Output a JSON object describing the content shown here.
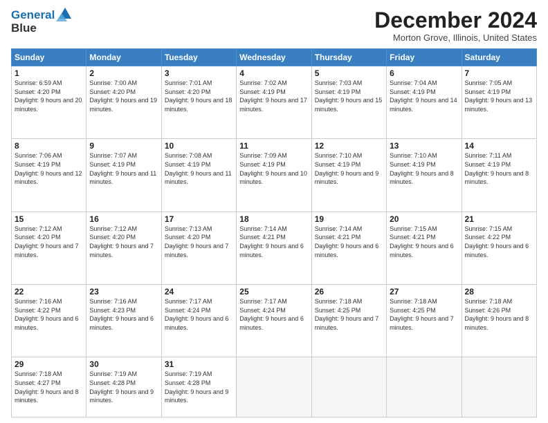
{
  "logo": {
    "line1": "General",
    "line2": "Blue"
  },
  "title": "December 2024",
  "location": "Morton Grove, Illinois, United States",
  "days_of_week": [
    "Sunday",
    "Monday",
    "Tuesday",
    "Wednesday",
    "Thursday",
    "Friday",
    "Saturday"
  ],
  "weeks": [
    [
      {
        "day": 1,
        "sunrise": "6:59 AM",
        "sunset": "4:20 PM",
        "daylight": "9 hours and 20 minutes."
      },
      {
        "day": 2,
        "sunrise": "7:00 AM",
        "sunset": "4:20 PM",
        "daylight": "9 hours and 19 minutes."
      },
      {
        "day": 3,
        "sunrise": "7:01 AM",
        "sunset": "4:20 PM",
        "daylight": "9 hours and 18 minutes."
      },
      {
        "day": 4,
        "sunrise": "7:02 AM",
        "sunset": "4:19 PM",
        "daylight": "9 hours and 17 minutes."
      },
      {
        "day": 5,
        "sunrise": "7:03 AM",
        "sunset": "4:19 PM",
        "daylight": "9 hours and 15 minutes."
      },
      {
        "day": 6,
        "sunrise": "7:04 AM",
        "sunset": "4:19 PM",
        "daylight": "9 hours and 14 minutes."
      },
      {
        "day": 7,
        "sunrise": "7:05 AM",
        "sunset": "4:19 PM",
        "daylight": "9 hours and 13 minutes."
      }
    ],
    [
      {
        "day": 8,
        "sunrise": "7:06 AM",
        "sunset": "4:19 PM",
        "daylight": "9 hours and 12 minutes."
      },
      {
        "day": 9,
        "sunrise": "7:07 AM",
        "sunset": "4:19 PM",
        "daylight": "9 hours and 11 minutes."
      },
      {
        "day": 10,
        "sunrise": "7:08 AM",
        "sunset": "4:19 PM",
        "daylight": "9 hours and 11 minutes."
      },
      {
        "day": 11,
        "sunrise": "7:09 AM",
        "sunset": "4:19 PM",
        "daylight": "9 hours and 10 minutes."
      },
      {
        "day": 12,
        "sunrise": "7:10 AM",
        "sunset": "4:19 PM",
        "daylight": "9 hours and 9 minutes."
      },
      {
        "day": 13,
        "sunrise": "7:10 AM",
        "sunset": "4:19 PM",
        "daylight": "9 hours and 8 minutes."
      },
      {
        "day": 14,
        "sunrise": "7:11 AM",
        "sunset": "4:19 PM",
        "daylight": "9 hours and 8 minutes."
      }
    ],
    [
      {
        "day": 15,
        "sunrise": "7:12 AM",
        "sunset": "4:20 PM",
        "daylight": "9 hours and 7 minutes."
      },
      {
        "day": 16,
        "sunrise": "7:12 AM",
        "sunset": "4:20 PM",
        "daylight": "9 hours and 7 minutes."
      },
      {
        "day": 17,
        "sunrise": "7:13 AM",
        "sunset": "4:20 PM",
        "daylight": "9 hours and 7 minutes."
      },
      {
        "day": 18,
        "sunrise": "7:14 AM",
        "sunset": "4:21 PM",
        "daylight": "9 hours and 6 minutes."
      },
      {
        "day": 19,
        "sunrise": "7:14 AM",
        "sunset": "4:21 PM",
        "daylight": "9 hours and 6 minutes."
      },
      {
        "day": 20,
        "sunrise": "7:15 AM",
        "sunset": "4:21 PM",
        "daylight": "9 hours and 6 minutes."
      },
      {
        "day": 21,
        "sunrise": "7:15 AM",
        "sunset": "4:22 PM",
        "daylight": "9 hours and 6 minutes."
      }
    ],
    [
      {
        "day": 22,
        "sunrise": "7:16 AM",
        "sunset": "4:22 PM",
        "daylight": "9 hours and 6 minutes."
      },
      {
        "day": 23,
        "sunrise": "7:16 AM",
        "sunset": "4:23 PM",
        "daylight": "9 hours and 6 minutes."
      },
      {
        "day": 24,
        "sunrise": "7:17 AM",
        "sunset": "4:24 PM",
        "daylight": "9 hours and 6 minutes."
      },
      {
        "day": 25,
        "sunrise": "7:17 AM",
        "sunset": "4:24 PM",
        "daylight": "9 hours and 6 minutes."
      },
      {
        "day": 26,
        "sunrise": "7:18 AM",
        "sunset": "4:25 PM",
        "daylight": "9 hours and 7 minutes."
      },
      {
        "day": 27,
        "sunrise": "7:18 AM",
        "sunset": "4:25 PM",
        "daylight": "9 hours and 7 minutes."
      },
      {
        "day": 28,
        "sunrise": "7:18 AM",
        "sunset": "4:26 PM",
        "daylight": "9 hours and 8 minutes."
      }
    ],
    [
      {
        "day": 29,
        "sunrise": "7:18 AM",
        "sunset": "4:27 PM",
        "daylight": "9 hours and 8 minutes."
      },
      {
        "day": 30,
        "sunrise": "7:19 AM",
        "sunset": "4:28 PM",
        "daylight": "9 hours and 9 minutes."
      },
      {
        "day": 31,
        "sunrise": "7:19 AM",
        "sunset": "4:28 PM",
        "daylight": "9 hours and 9 minutes."
      },
      null,
      null,
      null,
      null
    ]
  ],
  "labels": {
    "sunrise": "Sunrise:",
    "sunset": "Sunset:",
    "daylight": "Daylight:"
  }
}
